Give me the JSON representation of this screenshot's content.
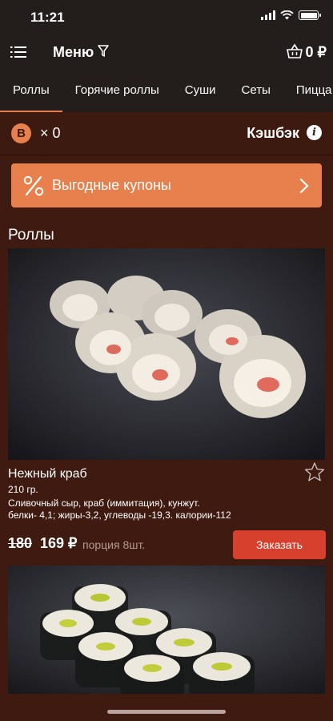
{
  "status_bar": {
    "time": "11:21"
  },
  "navbar": {
    "title": "Меню",
    "cart_total": "0 ₽"
  },
  "tabs": [
    {
      "label": "Роллы",
      "active": true
    },
    {
      "label": "Горячие роллы",
      "active": false
    },
    {
      "label": "Суши",
      "active": false
    },
    {
      "label": "Сеты",
      "active": false
    },
    {
      "label": "Пицца",
      "active": false
    }
  ],
  "cashback": {
    "coin_symbol": "B",
    "count": "× 0",
    "label": "Кэшбэк",
    "info_symbol": "i"
  },
  "coupons": {
    "label": "Выгодные купоны"
  },
  "section": {
    "title": "Роллы"
  },
  "product": {
    "name": "Нежный краб",
    "weight": "210 гр.",
    "ingredients": "Сливочный сыр, краб (иммитация), кунжут.",
    "nutrition": "белки- 4,1; жиры-3,2, углеводы -19,3. калории-112",
    "old_price": "180",
    "new_price": "169 ₽",
    "portion": "порция 8шт.",
    "order_button": "Заказать"
  },
  "colors": {
    "accent": "#e8804d",
    "order_button": "#d8402e",
    "background": "#3e1a10",
    "header": "#231d1b"
  },
  "icons": [
    "menu-list-icon",
    "filter-icon",
    "cart-basket-icon",
    "cashback-coin-icon",
    "info-icon",
    "percent-icon",
    "chevron-right-icon",
    "favorite-star-icon"
  ]
}
